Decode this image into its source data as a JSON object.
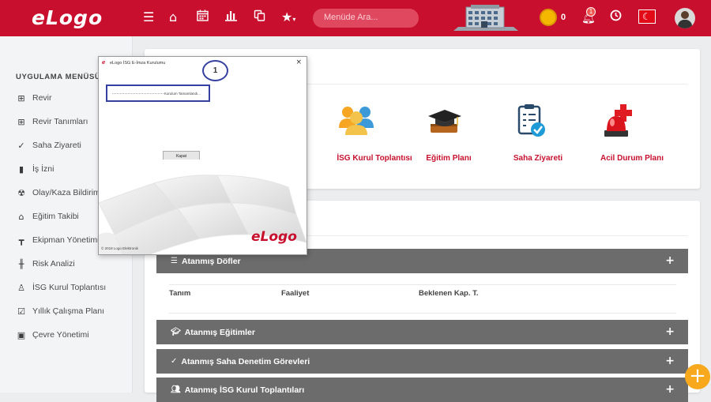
{
  "app": {
    "logo_text": "eLogo"
  },
  "topbar": {
    "search_placeholder": "Menüde Ara...",
    "coin_count": "0",
    "notification_count": "1",
    "icons": [
      "hamburger-icon",
      "home-icon",
      "calendar-icon",
      "bar-chart-icon",
      "copy-icon",
      "star-icon",
      "coins-icon",
      "bell-icon",
      "clock-icon",
      "flag-tr-icon"
    ]
  },
  "sidebar": {
    "title": "UYGULAMA MENÜSÜ",
    "items": [
      {
        "label": "Revir",
        "icon": "plus-square-icon"
      },
      {
        "label": "Revir Tanımları",
        "icon": "plus-square-icon"
      },
      {
        "label": "Saha Ziyareti",
        "icon": "check-icon"
      },
      {
        "label": "İş İzni",
        "icon": "file-icon"
      },
      {
        "label": "Olay/Kaza Bildirim",
        "icon": "alert-icon"
      },
      {
        "label": "Eğitim Takibi",
        "icon": "bank-icon"
      },
      {
        "label": "Ekipman Yönetimi",
        "icon": "paint-roller-icon"
      },
      {
        "label": "Risk Analizi",
        "icon": "waveform-icon"
      },
      {
        "label": "İSG Kurul Toplantısı",
        "icon": "user-icon"
      },
      {
        "label": "Yıllık Çalışma Planı",
        "icon": "checkbox-icon"
      },
      {
        "label": "Çevre Yönetimi",
        "icon": "calendar-icon"
      }
    ]
  },
  "shortcuts": [
    {
      "label": "İSG Kurul Toplantısı",
      "icon": "group-icon"
    },
    {
      "label": "Eğitim Planı",
      "icon": "graduation-cap-icon"
    },
    {
      "label": "Saha Ziyareti",
      "icon": "clipboard-check-icon"
    },
    {
      "label": "Acil Durum Planı",
      "icon": "siren-icon"
    }
  ],
  "panels": [
    {
      "title": "Atanmış Döfler",
      "icon": "list-icon"
    },
    {
      "title": "Atanmış Eğitimler",
      "icon": "graduation-cap-icon"
    },
    {
      "title": "Atanmış Saha Denetim Görevleri",
      "icon": "check-icon"
    },
    {
      "title": "Atanmış İSG Kurul Toplantıları",
      "icon": "group-icon"
    }
  ],
  "dof_table": {
    "columns": [
      "Tanım",
      "Faaliyet",
      "Beklenen Kap. T."
    ]
  },
  "dialog": {
    "title": "eLogo İSG E-İmza Kurulumu",
    "close": "×",
    "status": "Kurulum Tamamlandı...",
    "step_number": "1",
    "button_label": "Kapat",
    "brand": "eLogo",
    "copyright": "© 2018 Logo Elektronik"
  },
  "colors": {
    "brand_red": "#c8102e",
    "panel_gray": "#6c6c6c",
    "fab_orange": "#f7a81d"
  }
}
